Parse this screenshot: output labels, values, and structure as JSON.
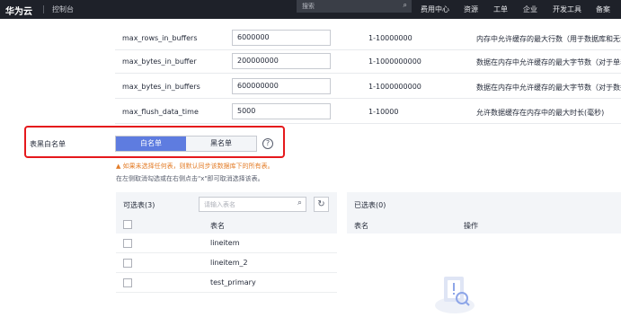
{
  "topbar": {
    "brand": "华为云",
    "console": "控制台",
    "search_placeholder": "搜索",
    "nav": [
      "费用中心",
      "资源",
      "工单",
      "企业",
      "开发工具",
      "备案"
    ]
  },
  "params": [
    {
      "name": "max_rows_in_buffers",
      "value": "6000000",
      "range": "1-10000000",
      "desc": "内存中允许缓存的最大行数（用于数据库和无法"
    },
    {
      "name": "max_bytes_in_buffer",
      "value": "200000000",
      "range": "1-1000000000",
      "desc": "数据在内存中允许缓存的最大字节数（对于单表"
    },
    {
      "name": "max_bytes_in_buffers",
      "value": "600000000",
      "range": "1-1000000000",
      "desc": "数据在内存中允许缓存的最大字节数（对于数据"
    },
    {
      "name": "max_flush_data_time",
      "value": "5000",
      "range": "1-10000",
      "desc": "允许数据缓存在内存中的最大时长(毫秒)"
    }
  ],
  "whitelist": {
    "label": "表黑白名单",
    "whitelist_btn": "白名单",
    "blacklist_btn": "黑名单",
    "help": "?",
    "warning": "▲ 如果未选择任何表，则默认同步该数据库下的所有表。",
    "hint": "在左侧取消勾选或在右侧点击\"x\"即可取消选择该表。"
  },
  "available": {
    "title": "可选表(3)",
    "search_placeholder": "请输入表名",
    "col_name": "表名",
    "rows": [
      "lineitem",
      "lineitem_2",
      "test_primary"
    ]
  },
  "selected": {
    "title": "已选表(0)",
    "col_name": "表名",
    "col_action": "操作"
  },
  "colors": {
    "topbar_bg": "#1e2129",
    "accent": "#5e7ce0",
    "highlight_border": "#e5191c",
    "warning": "#e37d29"
  }
}
